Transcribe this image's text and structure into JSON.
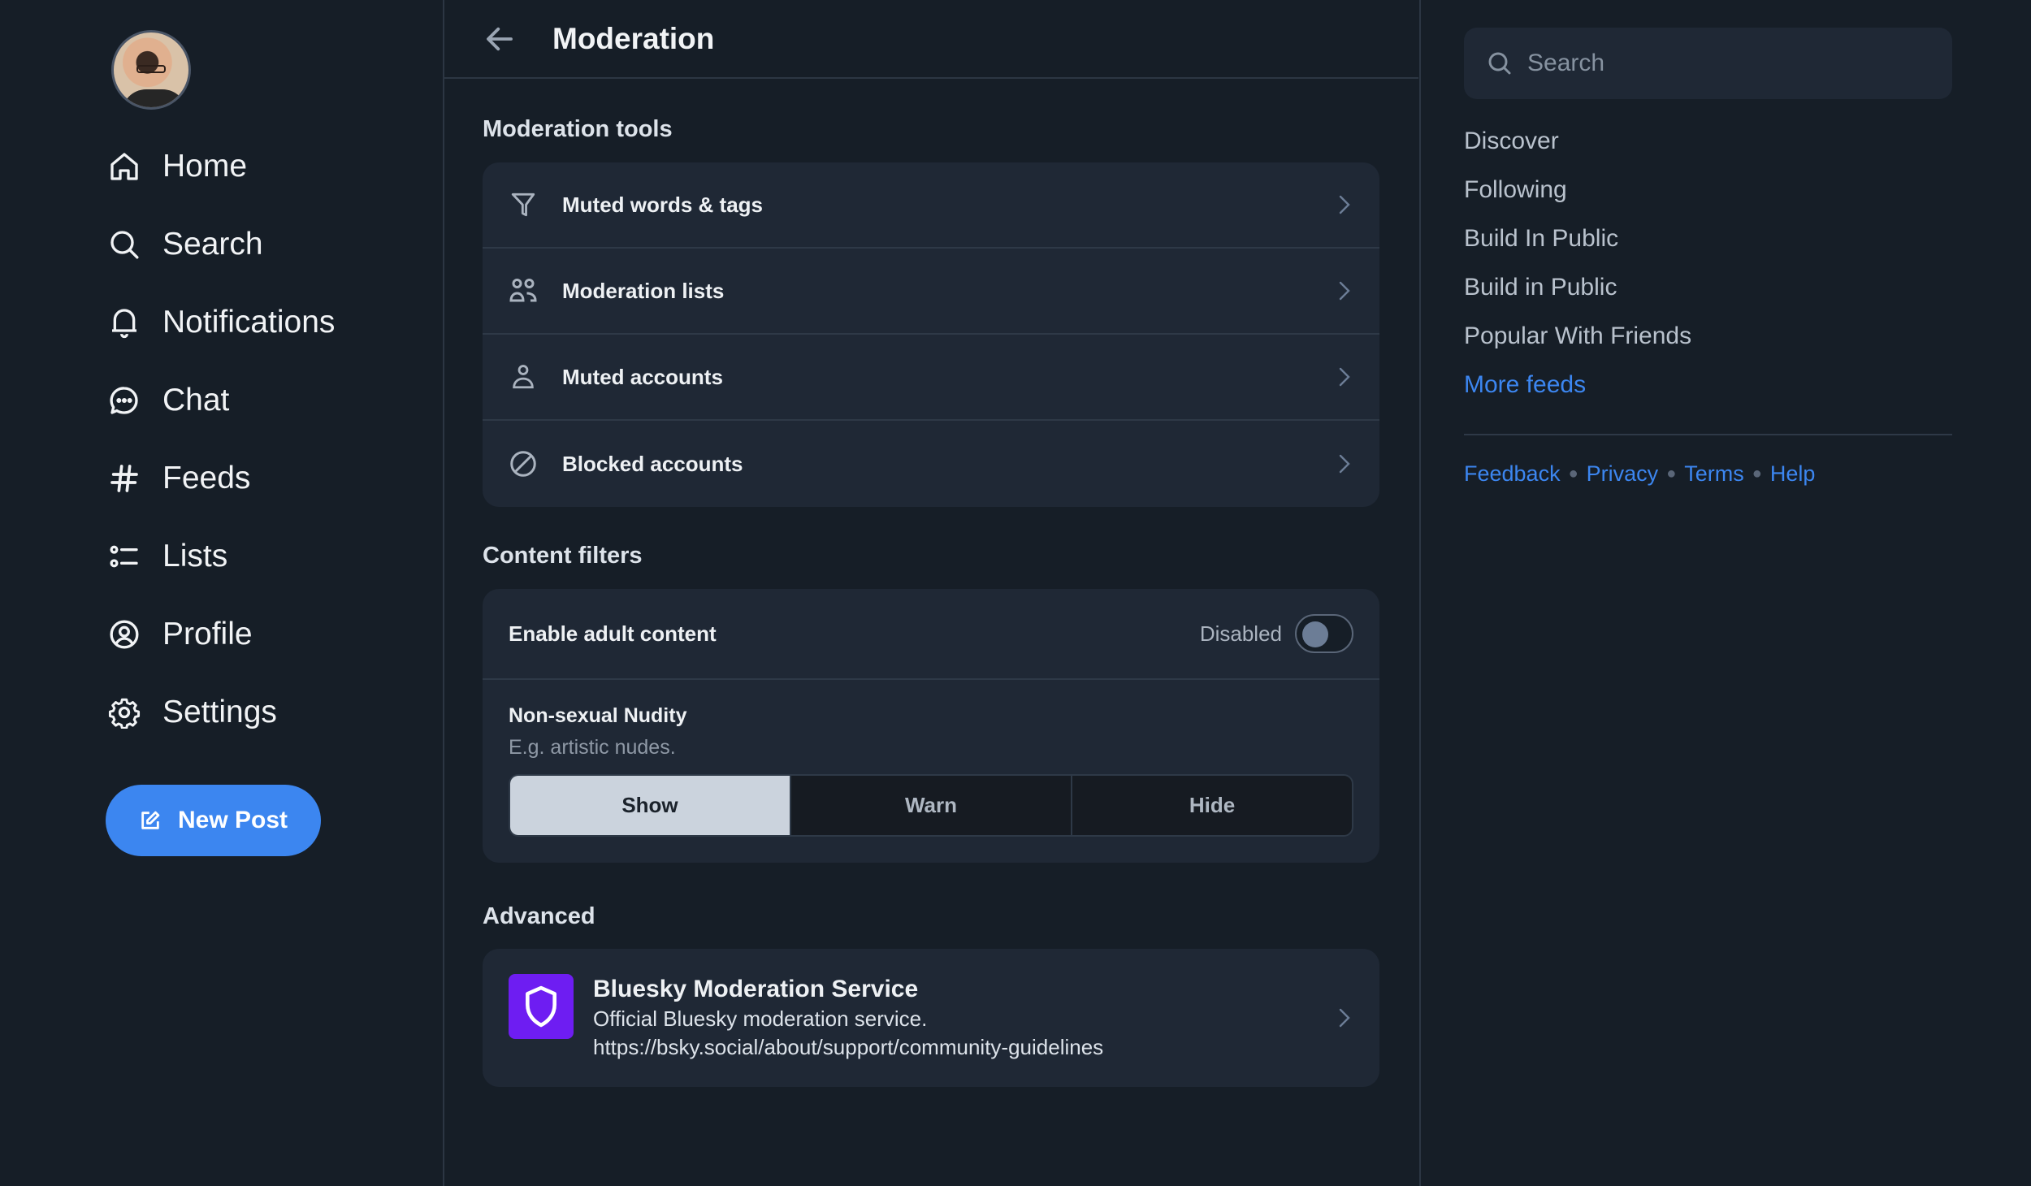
{
  "nav": {
    "avatar_alt": "User avatar",
    "items": [
      {
        "label": "Home",
        "icon": "home-icon"
      },
      {
        "label": "Search",
        "icon": "search-icon"
      },
      {
        "label": "Notifications",
        "icon": "bell-icon"
      },
      {
        "label": "Chat",
        "icon": "chat-icon"
      },
      {
        "label": "Feeds",
        "icon": "hashtag-icon"
      },
      {
        "label": "Lists",
        "icon": "list-icon"
      },
      {
        "label": "Profile",
        "icon": "user-circle-icon"
      },
      {
        "label": "Settings",
        "icon": "gear-icon"
      }
    ],
    "new_post_label": "New Post"
  },
  "header": {
    "title": "Moderation"
  },
  "moderation_tools": {
    "title": "Moderation tools",
    "items": [
      {
        "label": "Muted words & tags",
        "icon": "filter-icon"
      },
      {
        "label": "Moderation lists",
        "icon": "users-icon"
      },
      {
        "label": "Muted accounts",
        "icon": "user-icon"
      },
      {
        "label": "Blocked accounts",
        "icon": "block-icon"
      }
    ]
  },
  "content_filters": {
    "title": "Content filters",
    "adult": {
      "label": "Enable adult content",
      "status": "Disabled",
      "enabled": false
    },
    "nudity": {
      "name": "Non-sexual Nudity",
      "description": "E.g. artistic nudes.",
      "options": [
        "Show",
        "Warn",
        "Hide"
      ],
      "selected": "Show"
    }
  },
  "advanced": {
    "title": "Advanced",
    "service": {
      "name": "Bluesky Moderation Service",
      "description": "Official Bluesky moderation service.",
      "url": "https://bsky.social/about/support/community-guidelines"
    }
  },
  "right": {
    "search_placeholder": "Search",
    "feeds": [
      "Discover",
      "Following",
      "Build In Public",
      "Build in Public",
      "Popular With Friends"
    ],
    "more_feeds": "More feeds",
    "footer_links": [
      "Feedback",
      "Privacy",
      "Terms",
      "Help"
    ]
  },
  "colors": {
    "accent": "#3c86f0",
    "background": "#161e27",
    "card": "#1f2835",
    "service_logo": "#6e1df2"
  }
}
